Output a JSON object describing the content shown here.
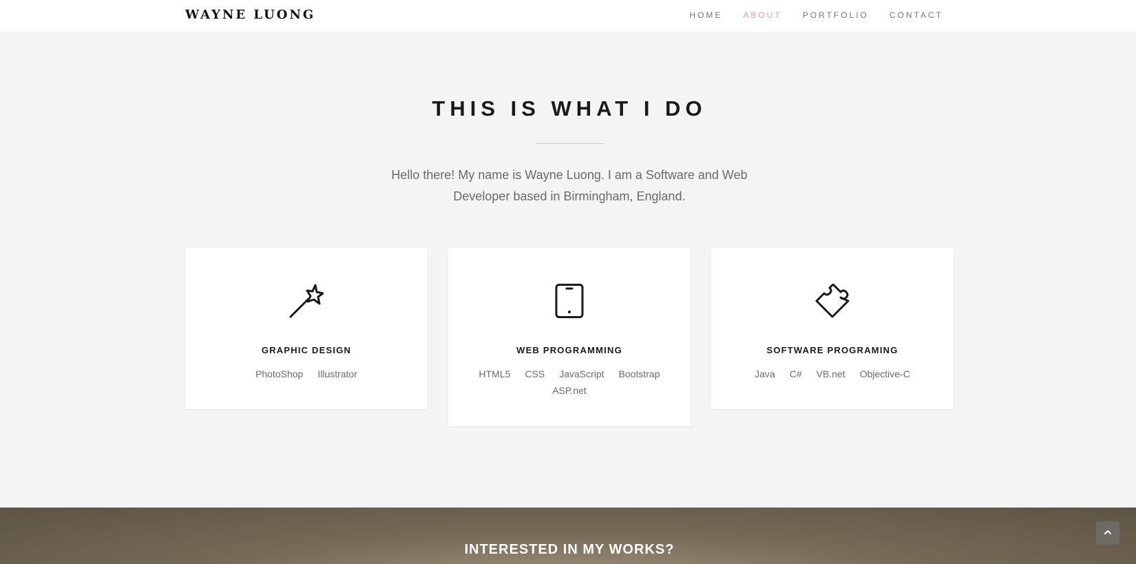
{
  "navbar": {
    "brand": "WAYNE LUONG",
    "links": [
      {
        "label": "HOME",
        "active": false
      },
      {
        "label": "ABOUT",
        "active": true
      },
      {
        "label": "PORTFOLIO",
        "active": false
      },
      {
        "label": "CONTACT",
        "active": false
      }
    ]
  },
  "about": {
    "title": "THIS IS WHAT I DO",
    "intro": "Hello there! My name is Wayne Luong. I am a Software and Web Developer based in Birmingham, England."
  },
  "services": [
    {
      "icon": "magic-wand-icon",
      "title": "GRAPHIC DESIGN",
      "skills": [
        "PhotoShop",
        "Illustrator"
      ]
    },
    {
      "icon": "tablet-icon",
      "title": "WEB PROGRAMMING",
      "skills": [
        "HTML5",
        "CSS",
        "JavaScript",
        "Bootstrap",
        "ASP.net"
      ]
    },
    {
      "icon": "puzzle-piece-icon",
      "title": "SOFTWARE PROGRAMING",
      "skills": [
        "Java",
        "C#",
        "VB.net",
        "Objective-C"
      ]
    }
  ],
  "works": {
    "title": "INTERESTED IN MY WORKS?"
  },
  "back_to_top": {
    "icon": "chevron-up-icon"
  },
  "colors": {
    "active_link": "#e0a090",
    "background": "#f4f4f4",
    "card": "#ffffff",
    "band": "#756a56"
  }
}
